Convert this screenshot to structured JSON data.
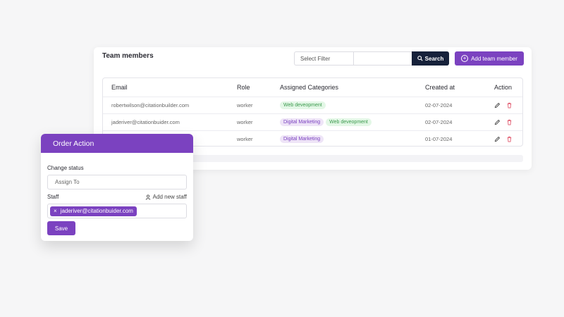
{
  "team": {
    "title": "Team members",
    "filter_label": "Select Filter",
    "filter_value": "",
    "search_label": "Search",
    "add_label": "Add team member",
    "columns": [
      "Email",
      "Role",
      "Assigned Categories",
      "Created at",
      "Action"
    ],
    "rows": [
      {
        "email": "robertwilson@citationbuilder.com",
        "role": "worker",
        "categories": [
          "Web deveopment"
        ],
        "created": "02-07-2024"
      },
      {
        "email": "jaderiver@citationbuider.com",
        "role": "worker",
        "categories": [
          "Digital Marketing",
          "Web deveopment"
        ],
        "created": "02-07-2024"
      },
      {
        "email": "",
        "role": "worker",
        "categories": [
          "Digital Marketing"
        ],
        "created": "01-07-2024"
      }
    ]
  },
  "modal": {
    "title": "Order Action",
    "status_label": "Change status",
    "status_value": "Assign To",
    "staff_label": "Staff",
    "add_staff_label": "Add new staff",
    "staff_chip": "jaderiver@citationbuider.com",
    "chip_remove": "×",
    "save_label": "Save"
  },
  "icons": {
    "edit": "pencil-icon",
    "delete": "trash-icon",
    "search": "search-icon",
    "add": "plus-circle-icon",
    "user": "user-icon"
  },
  "colors": {
    "accent": "#7b42c0",
    "dark": "#16213a",
    "danger": "#e0566b",
    "tag_green_bg": "#e3f7e6",
    "tag_purple_bg": "#eee4f7"
  }
}
